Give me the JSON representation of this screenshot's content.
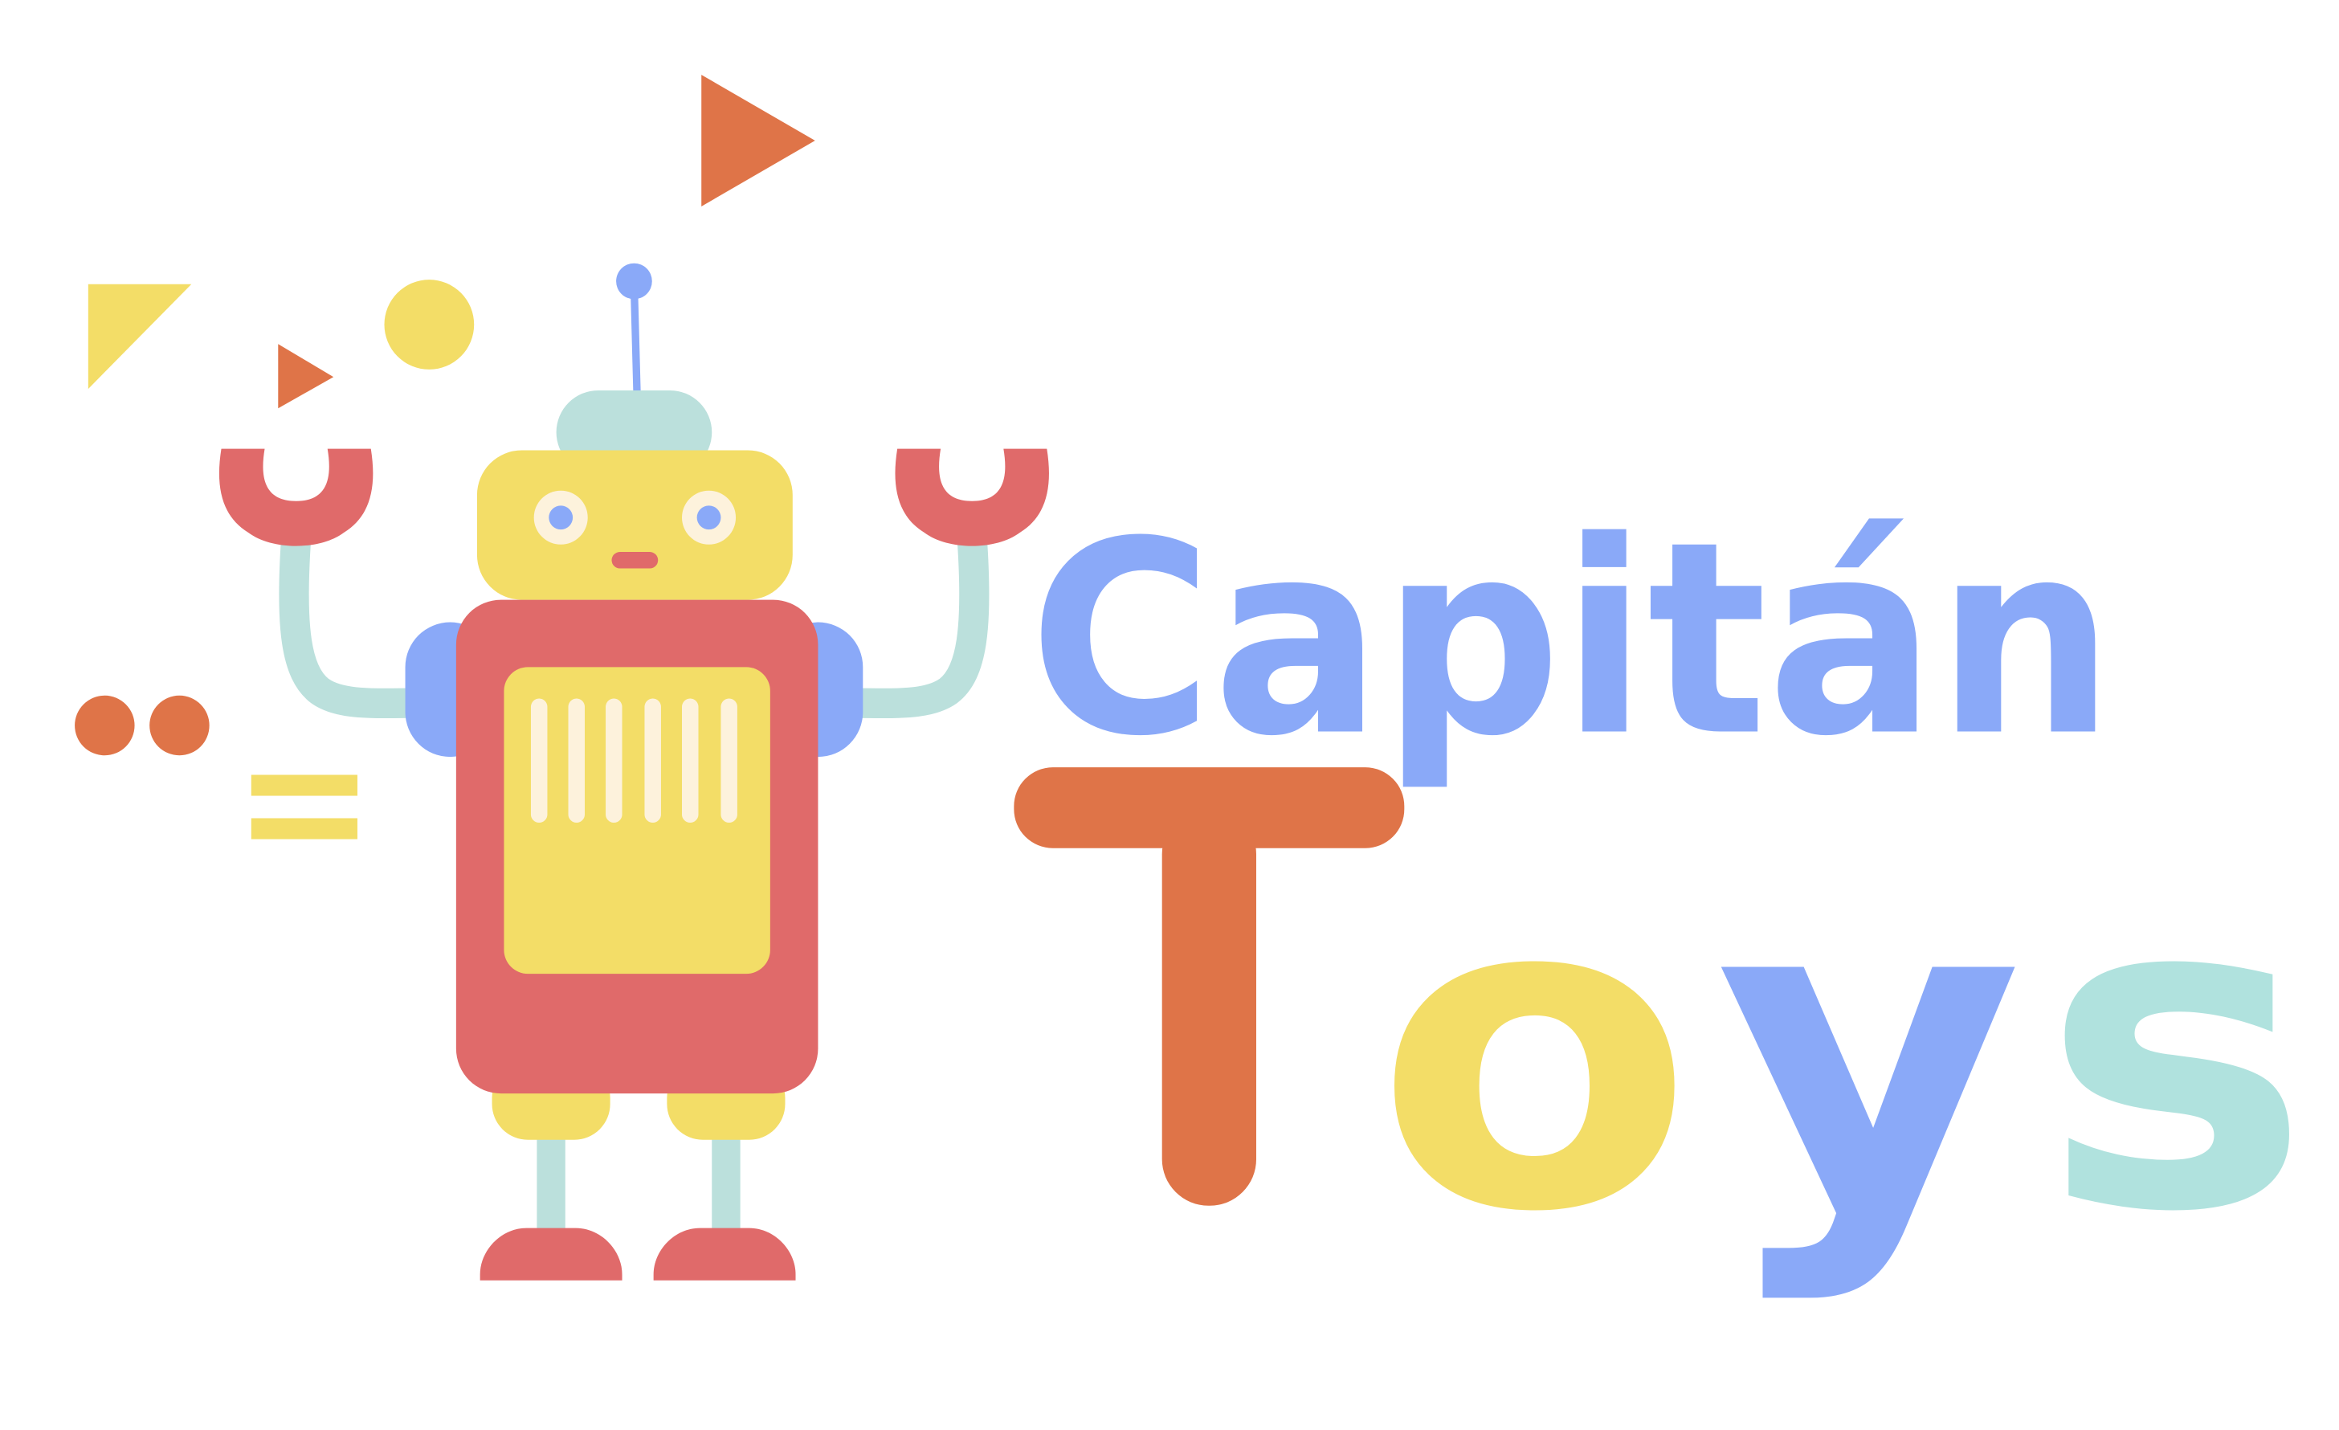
{
  "logo": {
    "word_top": "Capitán",
    "word_bottom": {
      "letter_1": "T",
      "letter_2": "o",
      "letter_3": "y",
      "letter_4": "s"
    }
  },
  "colors": {
    "blue": "#8aa9f8",
    "orange": "#df7448",
    "yellow": "#f3dd67",
    "red": "#e06a6a",
    "mint": "#bbe0dc",
    "mint_text": "#b0e2de",
    "cream": "#fdf2dc"
  },
  "icons": [
    "robot-icon",
    "triangle-icon",
    "circle-icon",
    "antenna-icon",
    "magnet-hand-icon"
  ]
}
